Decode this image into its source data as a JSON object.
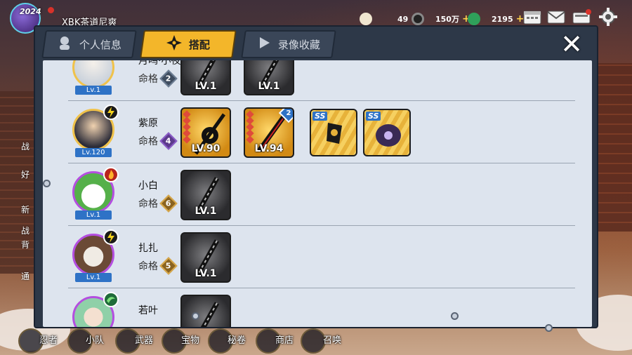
{
  "top_bar": {
    "year_badge": "2024",
    "player_name": "XBK茶道尼爽",
    "resources": [
      {
        "name": "house-currency",
        "value": "49"
      },
      {
        "name": "coin-currency",
        "value": "150万"
      },
      {
        "name": "gem-currency",
        "value": "2195"
      }
    ]
  },
  "tabs": [
    {
      "label": "个人信息",
      "active": false
    },
    {
      "label": "搭配",
      "active": true
    },
    {
      "label": "录像收藏",
      "active": false
    }
  ],
  "close_label": "✕",
  "mingge_label": "命格",
  "rows": [
    {
      "name": "月鸣·小夜",
      "level": "Lv.1",
      "mingge": "2",
      "items": [
        "LV.1",
        "LV.1"
      ]
    },
    {
      "name": "紫原",
      "level": "Lv.120",
      "mingge": "4",
      "items": [
        "LV.90",
        "LV.94"
      ],
      "item2_badge": "2",
      "scrolls": [
        "SS",
        "SS"
      ]
    },
    {
      "name": "小白",
      "level": "Lv.1",
      "mingge": "6",
      "items": [
        "LV.1"
      ]
    },
    {
      "name": "扎扎",
      "level": "Lv.1",
      "mingge": "5",
      "items": [
        "LV.1"
      ]
    },
    {
      "name": "若叶",
      "level": "",
      "mingge": "",
      "items": [
        ""
      ]
    }
  ],
  "bottom_nav": [
    "忍者",
    "小队",
    "武器",
    "宝物",
    "秘卷",
    "商店",
    "召唤"
  ],
  "left_side_labels": [
    "战",
    "好",
    "新",
    "战",
    "背",
    "通"
  ]
}
